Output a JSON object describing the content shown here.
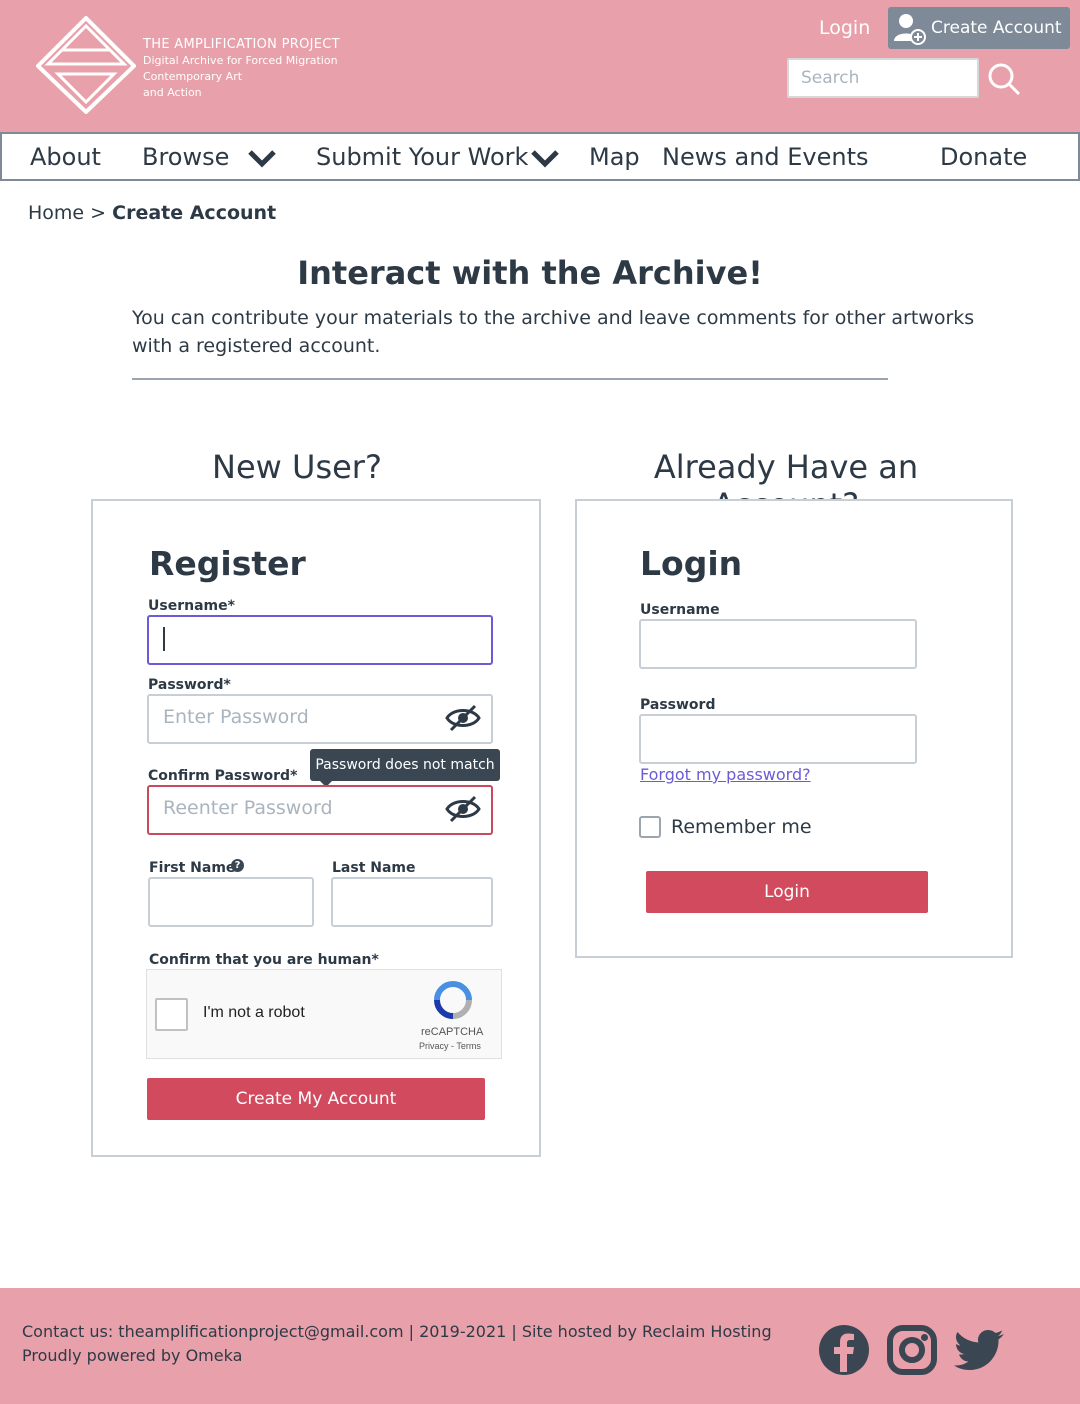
{
  "colors": {
    "header_bg": "#e8a0aa",
    "accent_button": "#d24a5e",
    "link": "#6b5bd6",
    "text": "#2d3a46"
  },
  "header": {
    "logo_title": "THE AMPLIFICATION PROJECT",
    "logo_sub1": "Digital Archive for Forced Migration",
    "logo_sub2": "Contemporary Art",
    "logo_sub3": "and Action",
    "login_label": "Login",
    "create_account_label": "Create Account",
    "search_placeholder": "Search"
  },
  "nav": {
    "about": "About",
    "browse": "Browse",
    "submit": "Submit Your Work",
    "map": "Map",
    "news": "News and Events",
    "donate": "Donate"
  },
  "breadcrumb": {
    "home": "Home >",
    "current": "Create Account"
  },
  "main": {
    "title": "Interact with the Archive!",
    "intro": "You can contribute your materials to the archive and leave comments for other artworks with a registered account."
  },
  "register": {
    "column_heading": "New User?",
    "heading": "Register",
    "username_label": "Username*",
    "password_label": "Password*",
    "password_placeholder": "Enter Password",
    "confirm_label": "Confirm Password*",
    "confirm_placeholder": "Reenter Password",
    "tooltip": "Password does not match",
    "first_name_label": "First Name",
    "last_name_label": "Last Name",
    "human_label": "Confirm that you are human*",
    "captcha_text": "I'm not a robot",
    "captcha_brand": "reCAPTCHA",
    "captcha_terms": "Privacy - Terms",
    "submit_label": "Create My Account"
  },
  "login": {
    "column_heading": "Already Have an Account?",
    "heading": "Login",
    "username_label": "Username",
    "password_label": "Password",
    "forgot_label": "Forgot my password?",
    "remember_label": "Remember me",
    "submit_label": "Login"
  },
  "footer": {
    "line1": "Contact us: theamplificationproject@gmail.com | 2019-2021 | Site hosted by Reclaim Hosting",
    "line2": "Proudly powered by Omeka",
    "icons": [
      "facebook-icon",
      "instagram-icon",
      "twitter-icon"
    ]
  }
}
